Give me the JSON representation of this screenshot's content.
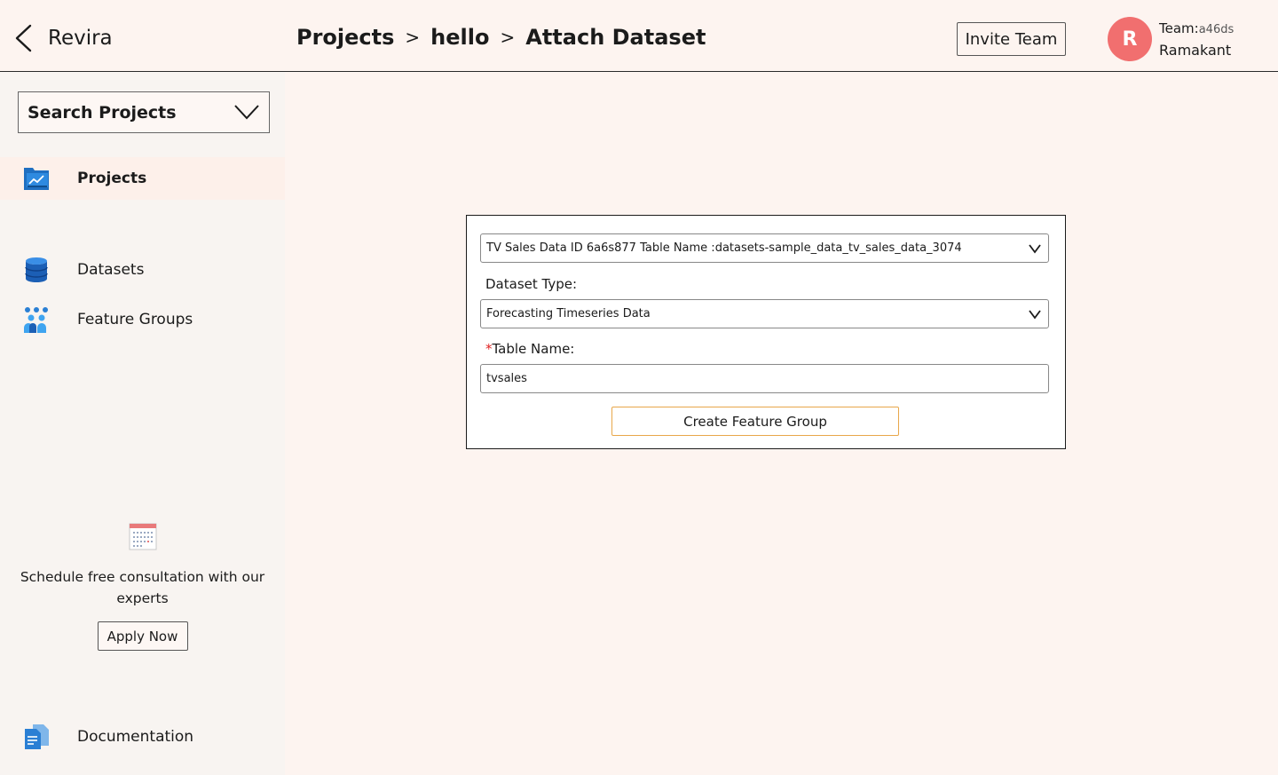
{
  "header": {
    "brand": "Revira",
    "breadcrumb": [
      "Projects",
      "hello",
      "Attach Dataset"
    ],
    "separator": ">",
    "invite_label": "Invite Team",
    "avatar_initial": "R",
    "team_label": "Team:",
    "team_id": "a46ds",
    "user_name": "Ramakant"
  },
  "sidebar": {
    "search_placeholder": "Search Projects",
    "items": [
      {
        "label": "Projects",
        "icon": "projects-chart-icon",
        "active": true
      },
      {
        "label": "Datasets",
        "icon": "database-icon",
        "active": false
      },
      {
        "label": "Feature Groups",
        "icon": "people-group-icon",
        "active": false
      }
    ],
    "consultation": {
      "icon": "calendar-icon",
      "text": "Schedule free consultation with our experts",
      "button": "Apply Now"
    },
    "documentation": {
      "label": "Documentation",
      "icon": "document-icon"
    }
  },
  "form": {
    "dataset_select_value": "TV Sales Data ID 6a6s877 Table Name :datasets-sample_data_tv_sales_data_3074",
    "dataset_type_label": "Dataset Type:",
    "dataset_type_value": "Forecasting Timeseries Data",
    "required_mark": "*",
    "table_name_label": "Table Name:",
    "table_name_value": "tvsales",
    "submit_label": "Create Feature Group"
  },
  "colors": {
    "background": "#fdf4f0",
    "sidebar": "#f8f4f1",
    "avatar": "#f16f6f",
    "create_button_border": "#e8a74a",
    "required": "#e02020"
  }
}
